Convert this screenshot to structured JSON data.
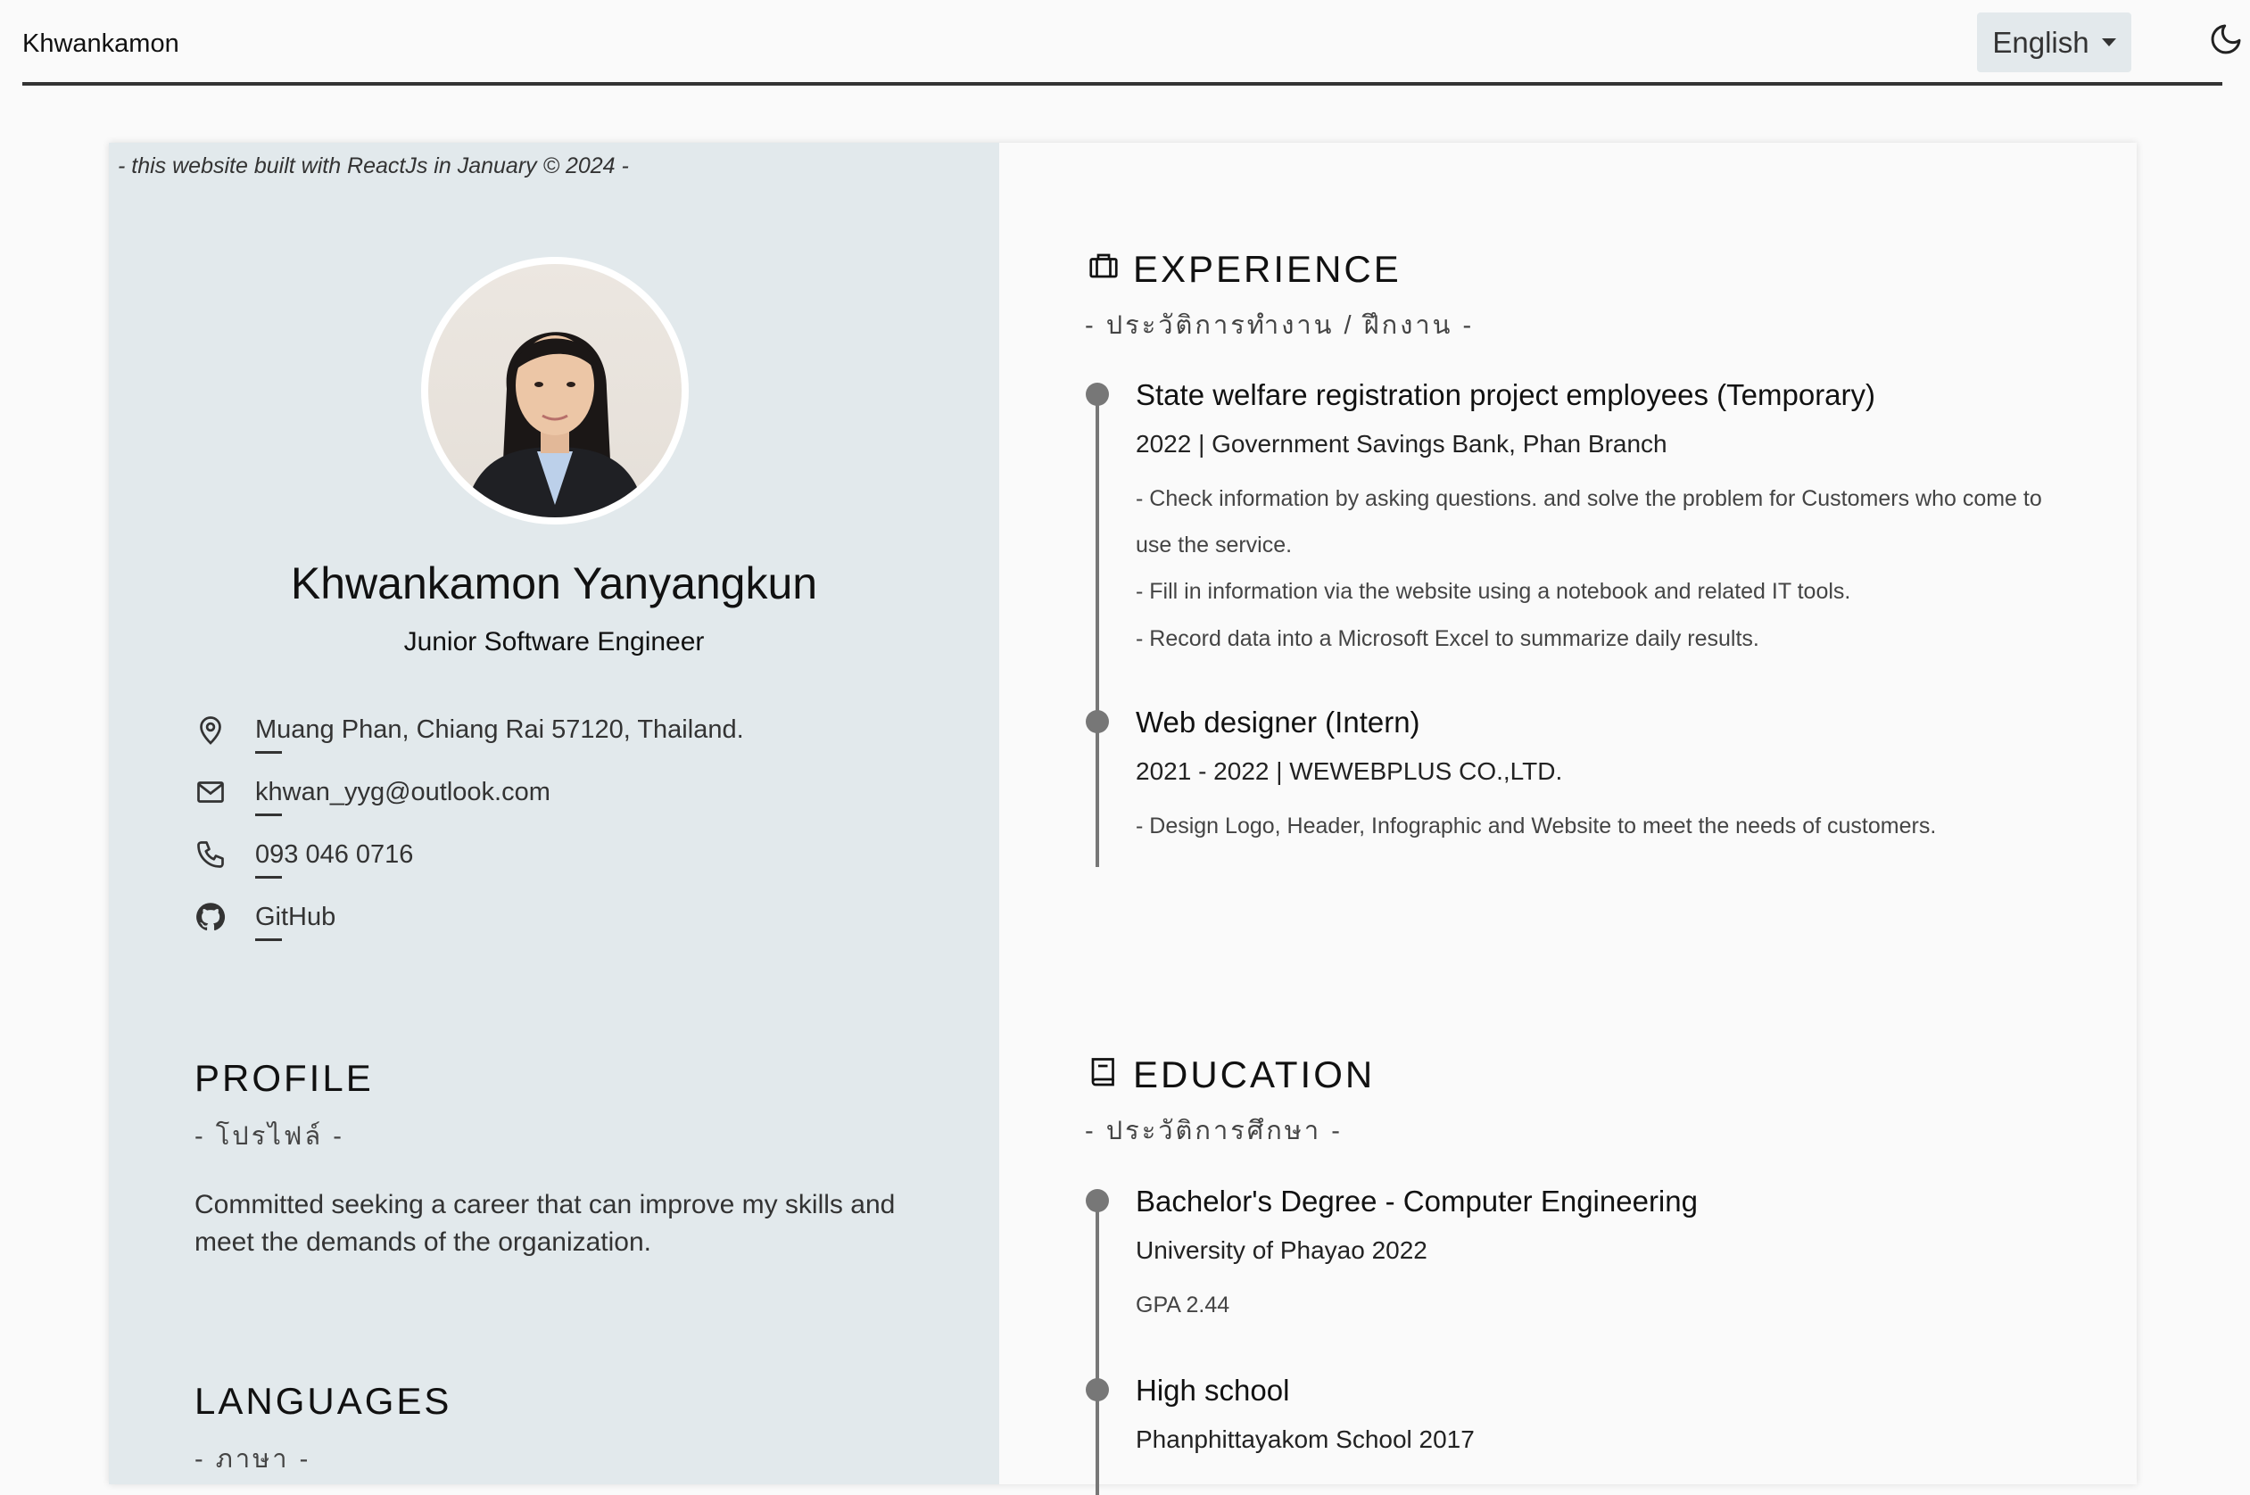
{
  "navbar": {
    "brand": "Khwankamon",
    "language": "English"
  },
  "sidebar": {
    "built_note": "- this website built with ReactJs in January © 2024 -",
    "name": "Khwankamon Yanyangkun",
    "job_title": "Junior Software Engineer",
    "contacts": {
      "address": "Muang Phan, Chiang Rai 57120, Thailand.",
      "email": "khwan_yyg@outlook.com",
      "phone": "093 046 0716",
      "github": "GitHub"
    },
    "profile": {
      "title": "PROFILE",
      "subtitle": "- โปรไฟล์ -",
      "text": "Committed seeking a career that can improve my skills and meet the demands of the organization."
    },
    "languages": {
      "title": "LANGUAGES",
      "subtitle": "- ภาษา -"
    }
  },
  "experience": {
    "title": "EXPERIENCE",
    "subtitle": "- ประวัติการทำงาน / ฝึกงาน -",
    "items": [
      {
        "title": "State welfare registration project employees (Temporary)",
        "subtitle": "2022 | Government Savings Bank, Phan Branch",
        "details": [
          "- Check information by asking questions. and solve the problem for Customers who come to use the service.",
          "- Fill in information via the website using a notebook and related IT tools.",
          "- Record data into a Microsoft Excel to summarize daily results."
        ]
      },
      {
        "title": "Web designer (Intern)",
        "subtitle": "2021 - 2022 | WEWEBPLUS CO.,LTD.",
        "details": [
          "- Design Logo, Header, Infographic and Website to meet the needs of customers."
        ]
      }
    ]
  },
  "education": {
    "title": "EDUCATION",
    "subtitle": "- ประวัติการศึกษา -",
    "items": [
      {
        "title": "Bachelor's Degree - Computer Engineering",
        "subtitle": "University of Phayao 2022",
        "detail": "GPA 2.44"
      },
      {
        "title": "High school",
        "subtitle": "Phanphittayakom School 2017"
      }
    ]
  }
}
